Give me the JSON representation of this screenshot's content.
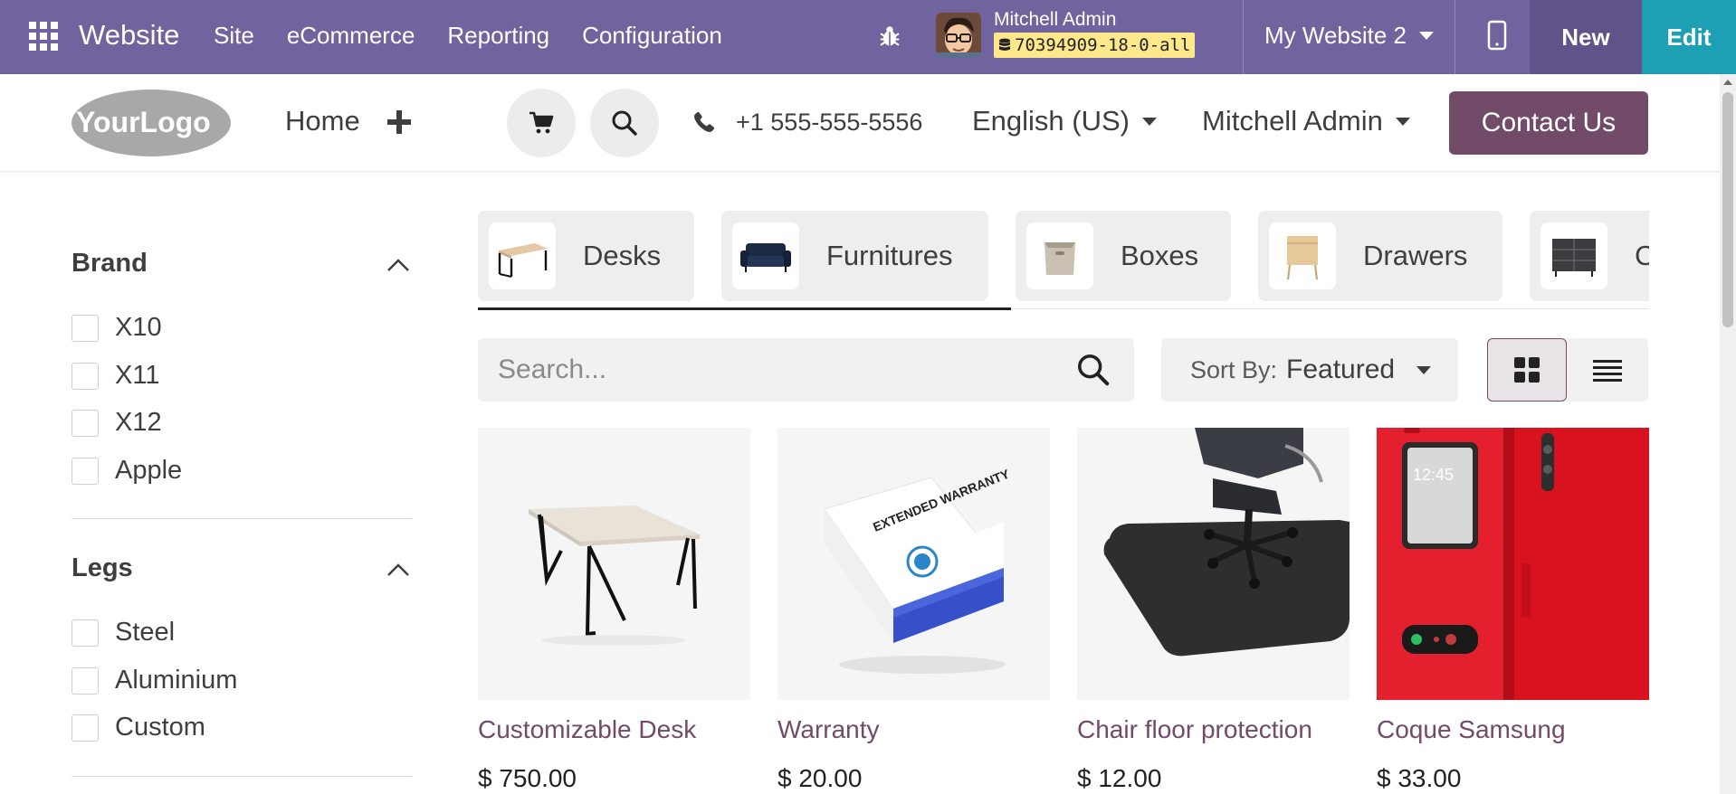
{
  "topbar": {
    "brand": "Website",
    "nav": [
      "Site",
      "eCommerce",
      "Reporting",
      "Configuration"
    ],
    "admin_name": "Mitchell Admin",
    "db_label": "70394909-18-0-all",
    "website_switch": "My Website 2",
    "new_label": "New",
    "edit_label": "Edit",
    "bg_color": "#71639e",
    "edit_color": "#1d9fb4"
  },
  "header": {
    "logo_text": "YourLogo",
    "home_label": "Home",
    "phone": "+1 555-555-5556",
    "language": "English (US)",
    "user": "Mitchell Admin",
    "contact_label": "Contact Us",
    "accent_color": "#714b67"
  },
  "sidebar": {
    "groups": [
      {
        "title": "Brand",
        "options": [
          "X10",
          "X11",
          "X12",
          "Apple"
        ]
      },
      {
        "title": "Legs",
        "options": [
          "Steel",
          "Aluminium",
          "Custom"
        ]
      }
    ]
  },
  "categories": [
    {
      "label": "Desks",
      "icon": "desk-thumbnail"
    },
    {
      "label": "Furnitures",
      "icon": "sofa-thumbnail"
    },
    {
      "label": "Boxes",
      "icon": "box-thumbnail"
    },
    {
      "label": "Drawers",
      "icon": "drawer-thumbnail"
    },
    {
      "label": "C",
      "icon": "cabinet-thumbnail"
    }
  ],
  "toolbar": {
    "search_placeholder": "Search...",
    "sort_prefix": "Sort By:",
    "sort_value": "Featured"
  },
  "products": [
    {
      "name": "Customizable Desk",
      "price": "$ 750.00"
    },
    {
      "name": "Warranty",
      "price": "$ 20.00"
    },
    {
      "name": "Chair floor protection",
      "price": "$ 12.00"
    },
    {
      "name": "Coque Samsung",
      "price": "$ 33.00"
    }
  ],
  "warranty_box_text": "EXTENDED WARRANTY",
  "phone_clock": "12:45"
}
